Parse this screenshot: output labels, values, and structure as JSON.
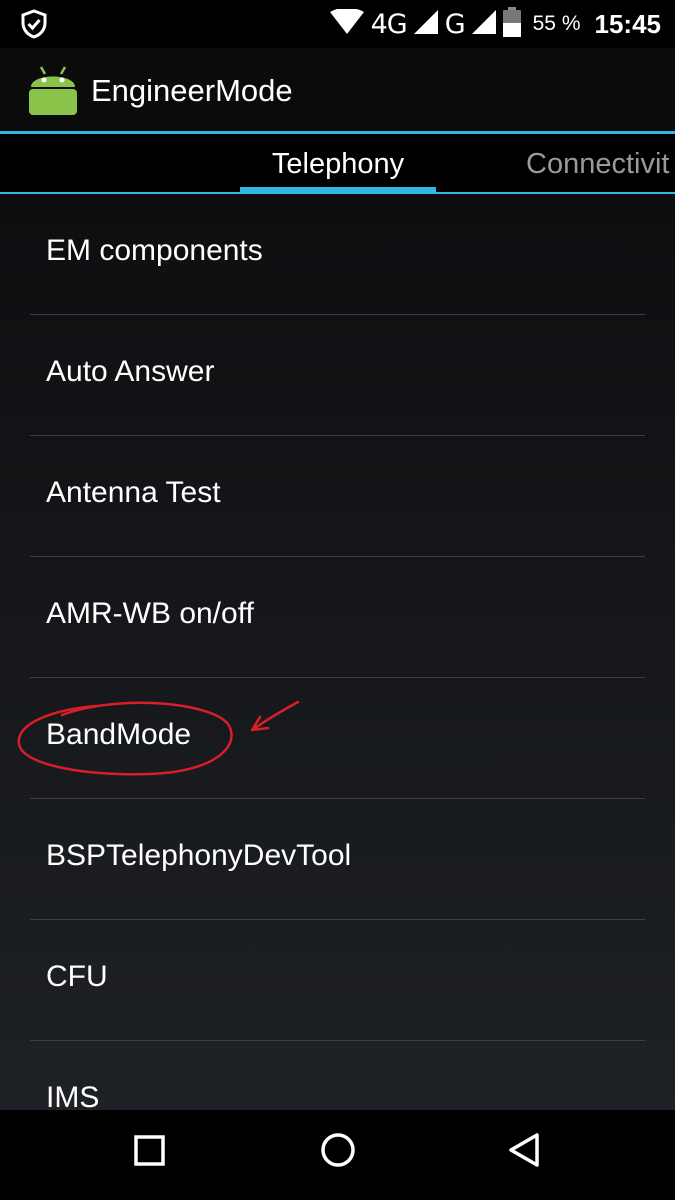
{
  "status_bar": {
    "network_primary": "4G",
    "network_secondary": "G",
    "battery_percent": "55 %",
    "time": "15:45",
    "icons": [
      "shield-check-icon",
      "wifi-icon",
      "signal-icon",
      "signal-icon",
      "battery-icon"
    ]
  },
  "app": {
    "title": "EngineerMode",
    "icon": "android-icon"
  },
  "tabs": [
    {
      "label": "Telephony",
      "selected": true
    },
    {
      "label": "Connectivit",
      "selected": false
    }
  ],
  "list": {
    "items": [
      {
        "label": "EM components"
      },
      {
        "label": "Auto Answer"
      },
      {
        "label": "Antenna Test"
      },
      {
        "label": "AMR-WB on/off"
      },
      {
        "label": "BandMode",
        "annotated": true
      },
      {
        "label": "BSPTelephonyDevTool"
      },
      {
        "label": "CFU"
      },
      {
        "label": "IMS"
      }
    ]
  },
  "nav_bar": {
    "icons": [
      "recents-square-icon",
      "home-circle-icon",
      "back-triangle-icon"
    ]
  },
  "colors": {
    "accent": "#33b5e5",
    "annotation": "#d81e28",
    "android_green": "#8bc34a"
  }
}
